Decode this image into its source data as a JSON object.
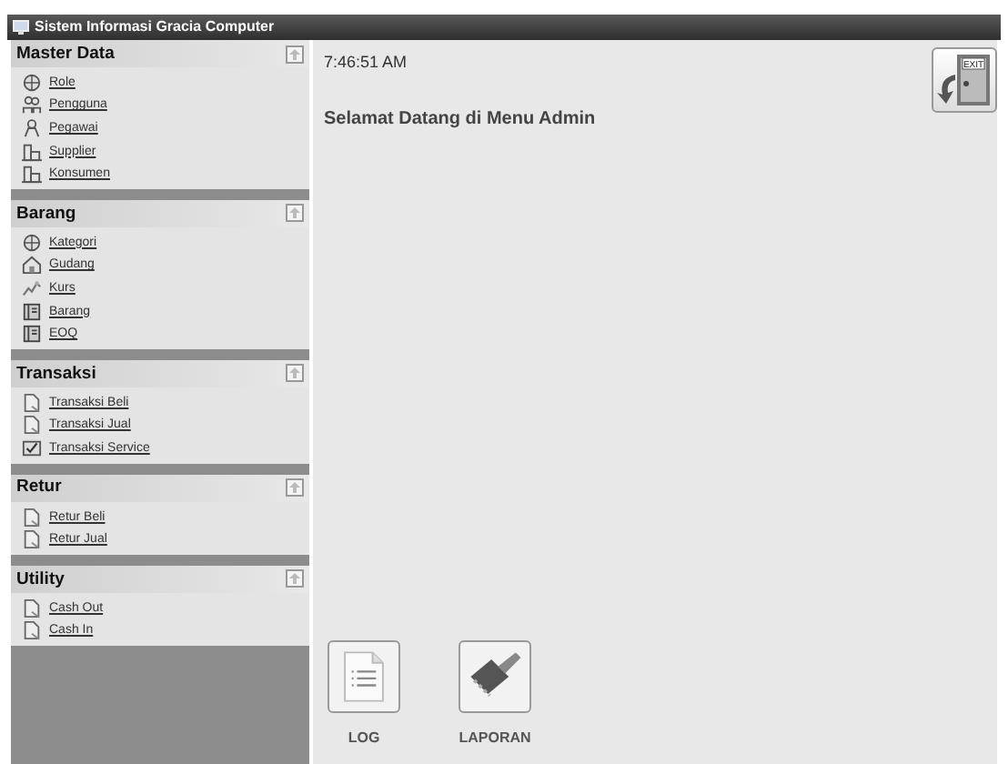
{
  "window": {
    "title": "Sistem Informasi Gracia Computer"
  },
  "sidebar": {
    "sections": [
      {
        "title": "Master Data",
        "items": [
          {
            "label": "Role",
            "kind": "globe"
          },
          {
            "label": "Pengguna",
            "kind": "users"
          },
          {
            "label": "Pegawai",
            "kind": "person"
          },
          {
            "label": "Supplier",
            "kind": "building"
          },
          {
            "label": "Konsumen",
            "kind": "building"
          }
        ]
      },
      {
        "title": "Barang",
        "items": [
          {
            "label": "Kategori",
            "kind": "globe"
          },
          {
            "label": "Gudang",
            "kind": "house"
          },
          {
            "label": "Kurs",
            "kind": "chart"
          },
          {
            "label": "Barang",
            "kind": "book"
          },
          {
            "label": "EOQ",
            "kind": "book"
          }
        ]
      },
      {
        "title": "Transaksi",
        "items": [
          {
            "label": "Transaksi Beli",
            "kind": "document"
          },
          {
            "label": "Transaksi Jual",
            "kind": "document"
          },
          {
            "label": "Transaksi Service",
            "kind": "check"
          }
        ]
      },
      {
        "title": "Retur",
        "items": [
          {
            "label": "Retur Beli",
            "kind": "document"
          },
          {
            "label": "Retur Jual",
            "kind": "document"
          }
        ]
      },
      {
        "title": "Utility",
        "items": [
          {
            "label": "Cash Out",
            "kind": "document"
          },
          {
            "label": "Cash In",
            "kind": "document"
          }
        ]
      }
    ]
  },
  "clock": "7:46:51 AM",
  "welcome": "Selamat Datang di Menu Admin",
  "exit_button": {
    "label": "EXIT"
  },
  "shortcuts": [
    {
      "label": "LOG",
      "kind": "log"
    },
    {
      "label": "LAPORAN",
      "kind": "report"
    }
  ]
}
